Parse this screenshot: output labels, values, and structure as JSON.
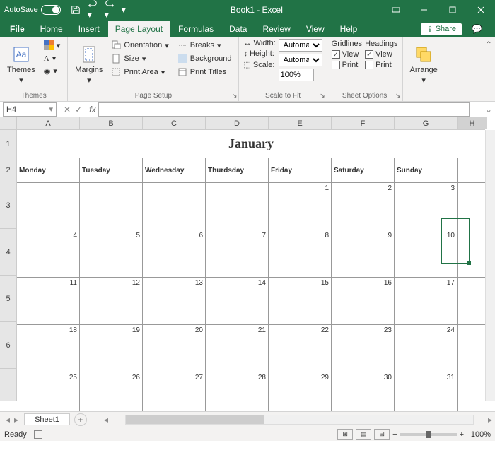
{
  "titlebar": {
    "autosave_label": "AutoSave",
    "autosave_state": "Off",
    "title": "Book1 - Excel"
  },
  "tabs": {
    "file": "File",
    "home": "Home",
    "insert": "Insert",
    "page_layout": "Page Layout",
    "formulas": "Formulas",
    "data": "Data",
    "review": "Review",
    "view": "View",
    "help": "Help",
    "share": "Share"
  },
  "ribbon": {
    "themes": {
      "themes_btn": "Themes",
      "group_label": "Themes"
    },
    "page_setup": {
      "margins": "Margins",
      "orientation": "Orientation",
      "size": "Size",
      "print_area": "Print Area",
      "breaks": "Breaks",
      "background": "Background",
      "print_titles": "Print Titles",
      "group_label": "Page Setup"
    },
    "scale_to_fit": {
      "width_label": "Width:",
      "width_value": "Automatic",
      "height_label": "Height:",
      "height_value": "Automatic",
      "scale_label": "Scale:",
      "scale_value": "100%",
      "group_label": "Scale to Fit"
    },
    "sheet_options": {
      "gridlines": "Gridlines",
      "headings": "Headings",
      "view": "View",
      "print": "Print",
      "group_label": "Sheet Options"
    },
    "arrange": {
      "arrange_btn": "Arrange",
      "group_label": ""
    }
  },
  "namebox": {
    "value": "H4"
  },
  "grid": {
    "columns": [
      "A",
      "B",
      "C",
      "D",
      "E",
      "F",
      "G",
      "H"
    ],
    "row_nums": [
      "1",
      "2",
      "3",
      "4",
      "5",
      "6"
    ],
    "calendar_title": "January",
    "weekdays": [
      "Monday",
      "Tuesday",
      "Wednesday",
      "Thurdsday",
      "Friday",
      "Saturday",
      "Sunday"
    ],
    "weeks": [
      [
        "",
        "",
        "",
        "",
        "1",
        "2",
        "3"
      ],
      [
        "4",
        "5",
        "6",
        "7",
        "8",
        "9",
        "10"
      ],
      [
        "11",
        "12",
        "13",
        "14",
        "15",
        "16",
        "17"
      ],
      [
        "18",
        "19",
        "20",
        "21",
        "22",
        "23",
        "24"
      ],
      [
        "25",
        "26",
        "27",
        "28",
        "29",
        "30",
        "31"
      ]
    ]
  },
  "sheets": {
    "sheet1": "Sheet1"
  },
  "status": {
    "ready": "Ready",
    "zoom": "100%"
  }
}
